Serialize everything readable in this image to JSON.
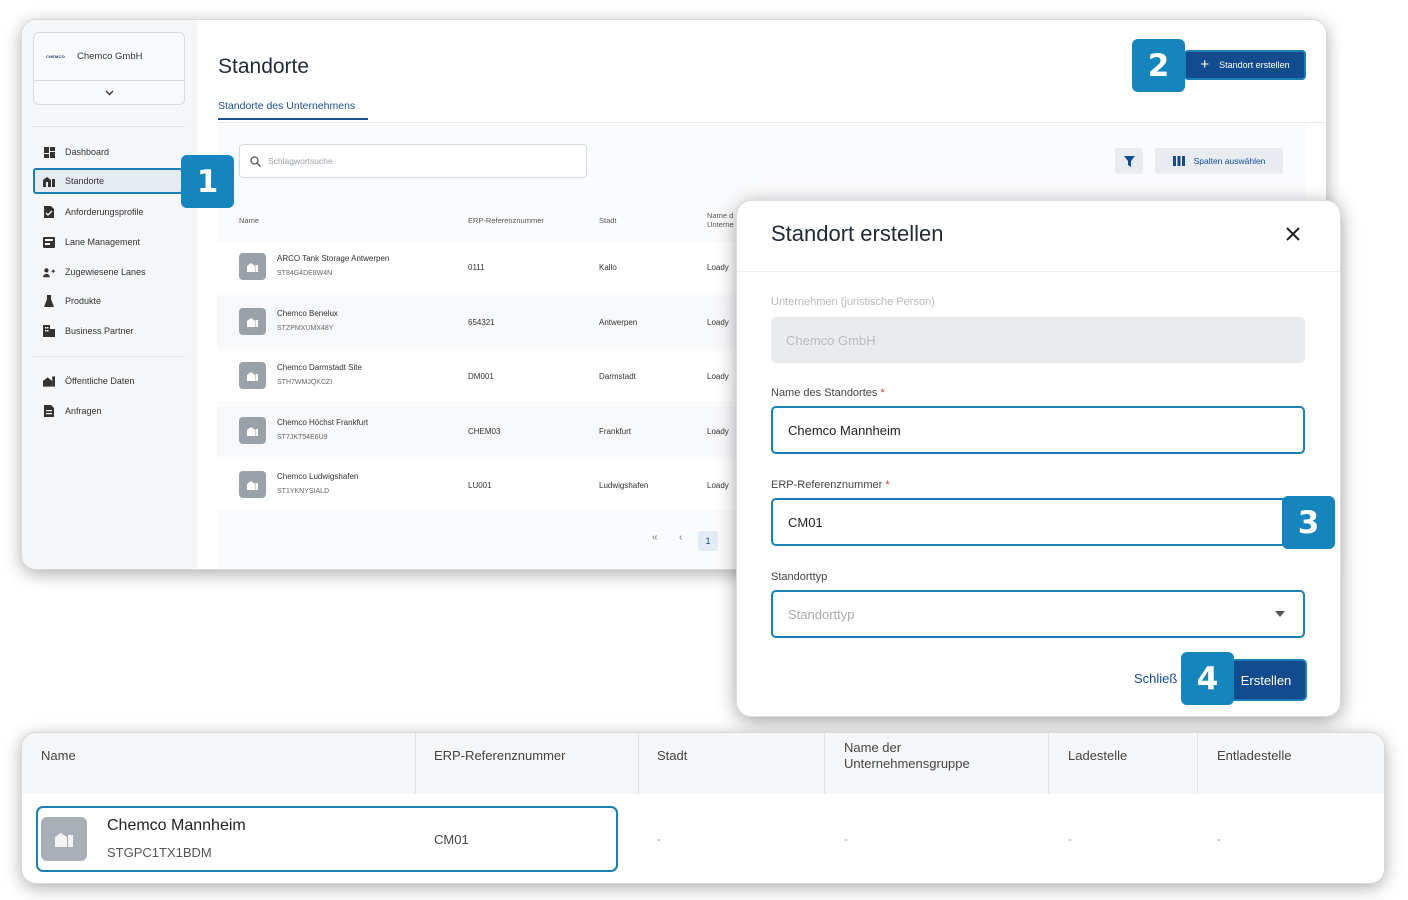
{
  "app": {
    "company_name": "Chemco GmbH",
    "logo_text": "CHEMCO",
    "chevron": "⌄"
  },
  "sidebar": {
    "items": [
      {
        "label": "Dashboard",
        "icon": "dashboard-icon"
      },
      {
        "label": "Standorte",
        "icon": "location-icon",
        "active": true
      },
      {
        "label": "Anforderungsprofile",
        "icon": "profile-doc-icon"
      },
      {
        "label": "Lane Management",
        "icon": "lane-icon"
      },
      {
        "label": "Zugewiesene Lanes",
        "icon": "assigned-users-icon"
      },
      {
        "label": "Produkte",
        "icon": "flask-icon"
      },
      {
        "label": "Business Partner",
        "icon": "building-icon"
      },
      {
        "label": "Öffentliche Daten",
        "icon": "public-data-icon"
      },
      {
        "label": "Anfragen",
        "icon": "request-doc-icon"
      }
    ]
  },
  "page": {
    "title": "Standorte",
    "tab": "Standorte des Unternehmens",
    "create_button": "Standort erstellen",
    "search_placeholder": "Schlagwortsuche",
    "columns_button": "Spalten auswählen"
  },
  "table": {
    "headers": [
      "Name",
      "ERP-Referenznummer",
      "Stadt",
      "Name d\nUnterne"
    ],
    "rows": [
      {
        "name": "ARCO Tank Storage Antwerpen",
        "id": "ST84G4DE8W4N",
        "erp": "0111",
        "city": "Kallo",
        "group": "Loady"
      },
      {
        "name": "Chemco Benelux",
        "id": "STZPMXUMX48Y",
        "erp": "654321",
        "city": "Antwerpen",
        "group": "Loady"
      },
      {
        "name": "Chemco Darmstadt Site",
        "id": "STH7WMJQKCZI",
        "erp": "DM001",
        "city": "Darmstadt",
        "group": "Loady"
      },
      {
        "name": "Chemco Höchst Frankfurt",
        "id": "ST7JKT54E6U9",
        "erp": "CHEM03",
        "city": "Frankfurt",
        "group": "Loady"
      },
      {
        "name": "Chemco Ludwigshafen",
        "id": "ST1YKNYSIALD",
        "erp": "LU001",
        "city": "Ludwigshafen",
        "group": "Loady"
      }
    ],
    "pagination": {
      "first": "«",
      "prev": "‹",
      "current": "1"
    }
  },
  "badges": [
    "1",
    "2",
    "3",
    "4"
  ],
  "modal": {
    "title": "Standort erstellen",
    "close_icon": "×",
    "company_label": "Unternehmen (juristische Person)",
    "company_value": "Chemco GmbH",
    "name_label": "Name des Standortes",
    "name_value": "Chemco Mannheim",
    "erp_label": "ERP-Referenznummer",
    "erp_value": "CM01",
    "type_label": "Standorttyp",
    "type_placeholder": "Standorttyp",
    "required_mark": "*",
    "cancel": "Schließ",
    "submit": "Erstellen"
  },
  "result": {
    "headers": [
      "Name",
      "ERP-Referenznummer",
      "Stadt",
      "Name der\nUnternehmensgruppe",
      "Ladestelle",
      "Entladestelle"
    ],
    "row": {
      "name": "Chemco Mannheim",
      "id": "STGPC1TX1BDM",
      "erp": "CM01",
      "city": "-",
      "group": "-",
      "loading": "-",
      "unloading": "-"
    }
  },
  "colors": {
    "primary": "#134b8f",
    "highlight": "#1685bd",
    "outline": "#1a7fb5"
  }
}
